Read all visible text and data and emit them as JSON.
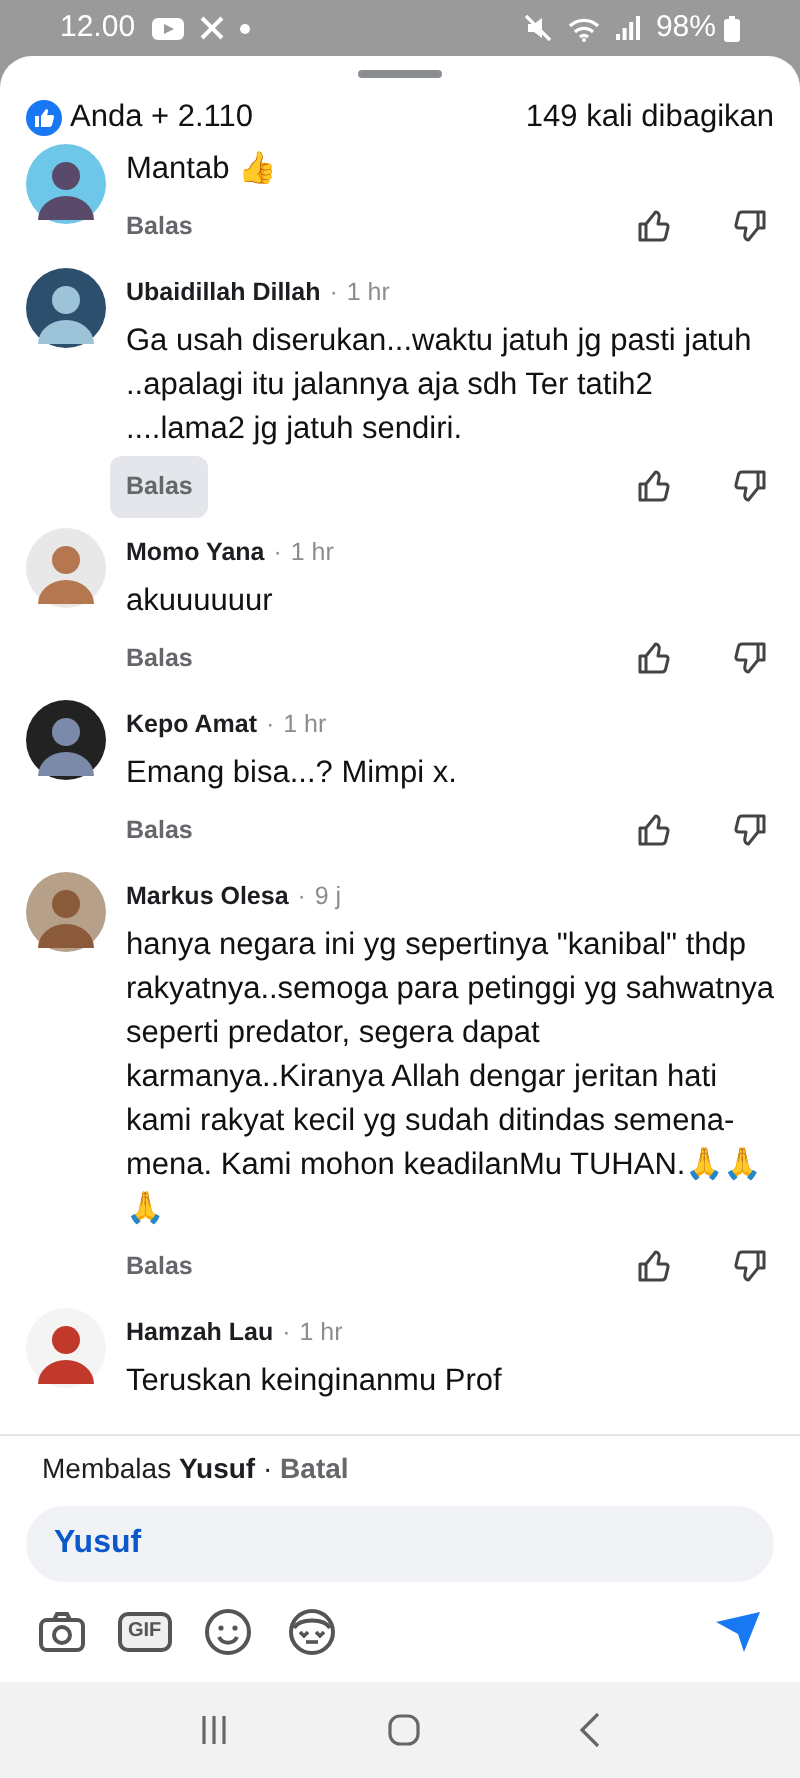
{
  "status_bar": {
    "time": "12.00",
    "battery": "98%"
  },
  "header": {
    "reactions": "Anda + 2.110",
    "shares": "149 kali dibagikan"
  },
  "comments": [
    {
      "text": "Mantab 👍",
      "reply_label": "Balas",
      "reply_highlighted": false
    },
    {
      "author": "Ubaidillah Dillah",
      "separator": "·",
      "time": "1 hr",
      "text": "Ga usah diserukan...waktu jatuh jg pasti jatuh ..apalagi itu jalannya aja sdh Ter tatih2 ....lama2 jg jatuh sendiri.",
      "reply_label": "Balas",
      "reply_highlighted": true
    },
    {
      "author": "Momo Yana",
      "separator": "·",
      "time": "1 hr",
      "text": "akuuuuuur",
      "reply_label": "Balas",
      "reply_highlighted": false
    },
    {
      "author": "Kepo Amat",
      "separator": "·",
      "time": "1 hr",
      "text": "Emang bisa...? Mimpi x.",
      "reply_label": "Balas",
      "reply_highlighted": false
    },
    {
      "author": "Markus Olesa",
      "separator": "·",
      "time": "9 j",
      "text": "hanya negara ini yg sepertinya \"kanibal\" thdp rakyatnya..semoga para petinggi yg sahwatnya seperti predator, segera dapat karmanya..Kiranya Allah dengar jeritan hati kami rakyat kecil yg sudah ditindas semena-mena. Kami mohon keadilanMu TUHAN.🙏🙏🙏",
      "reply_label": "Balas",
      "reply_highlighted": false
    },
    {
      "author": "Hamzah Lau",
      "separator": "·",
      "time": "1 hr",
      "text": "Teruskan keinginanmu Prof"
    }
  ],
  "composer": {
    "replying_prefix": "Membalas",
    "replying_to": "Yusuf",
    "separator": "·",
    "cancel": "Batal",
    "value": "Yusuf",
    "tools": [
      {
        "kind": "camera"
      },
      {
        "kind": "gif",
        "label": "GIF"
      },
      {
        "kind": "emoji"
      },
      {
        "kind": "sticker"
      }
    ]
  }
}
